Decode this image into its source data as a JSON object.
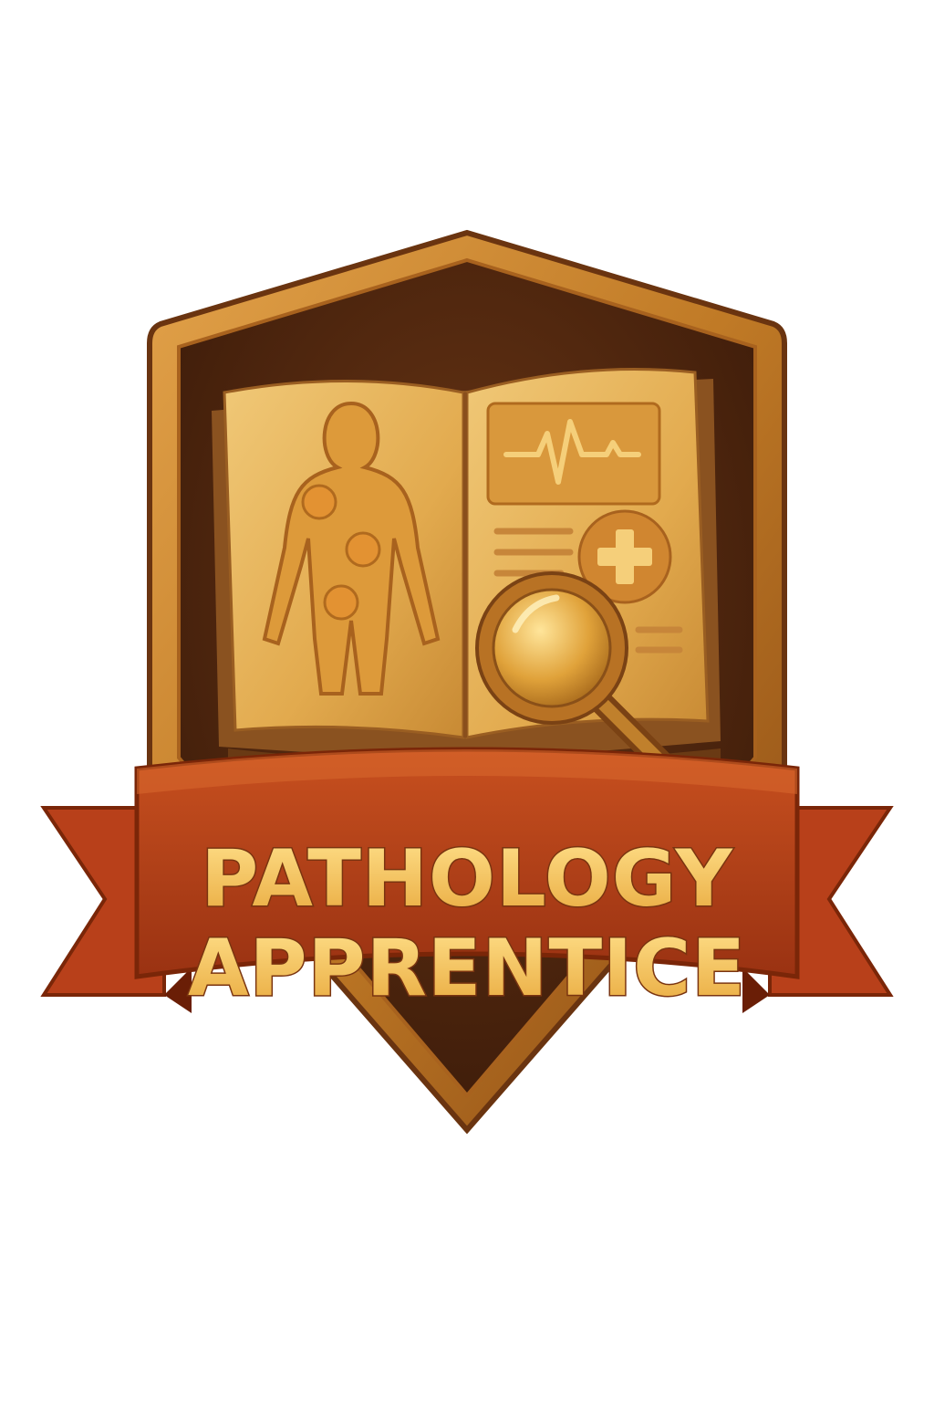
{
  "badge": {
    "title_line_1": "PATHOLOGY",
    "title_line_2": "APPRENTICE"
  },
  "colors": {
    "frame_gold": "#c8842a",
    "frame_dark": "#7a3f10",
    "wood_background": "#4a2410",
    "parchment": "#e7b45a",
    "ribbon_red": "#b8401a",
    "ribbon_dark": "#8a2a0c",
    "text_gold": "#f2c35c"
  },
  "icons": [
    "shield-frame",
    "open-book",
    "human-body-figure",
    "heartbeat-line",
    "medical-cross",
    "magnifying-glass",
    "ribbon-banner"
  ]
}
